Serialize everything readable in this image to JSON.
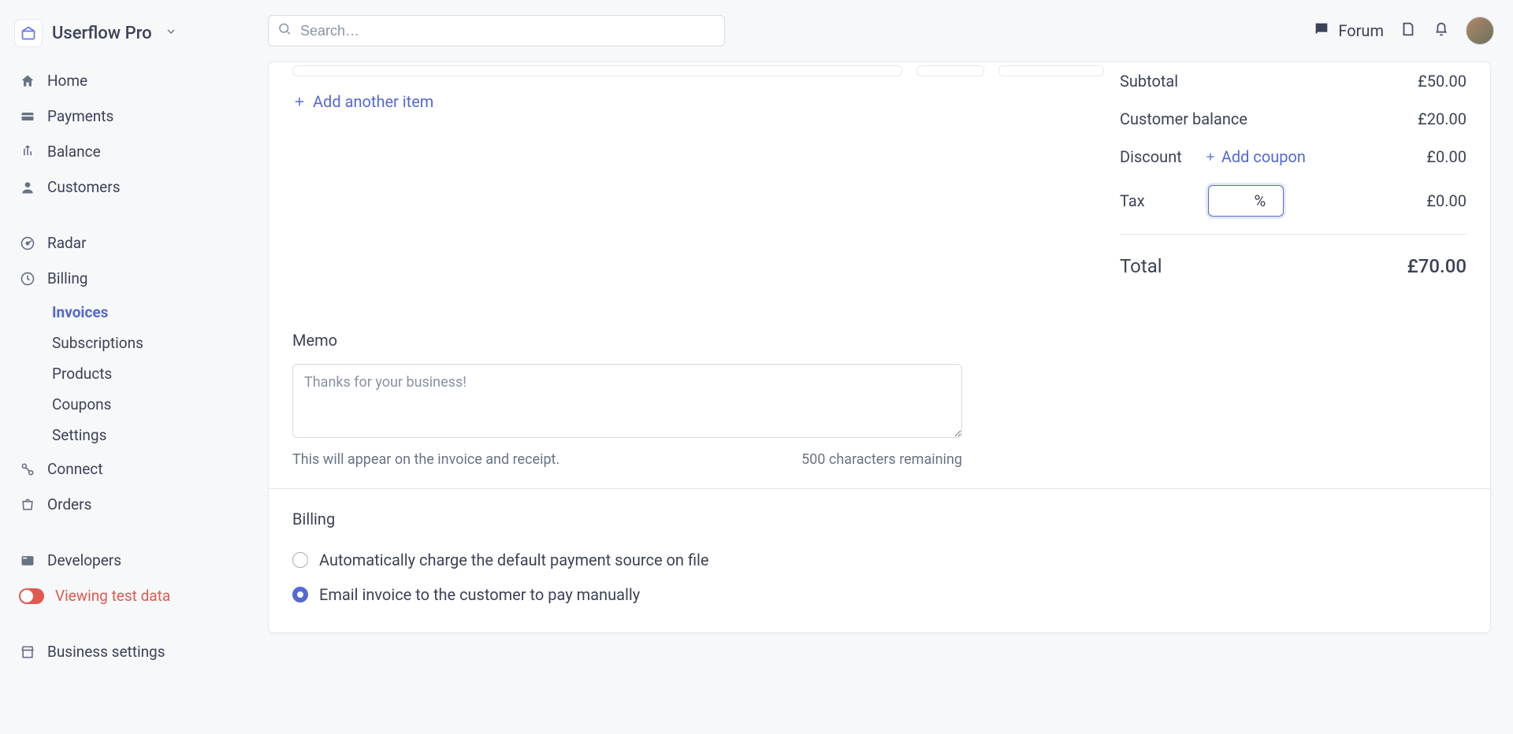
{
  "workspace": {
    "name": "Userflow Pro"
  },
  "search": {
    "placeholder": "Search…"
  },
  "topbar": {
    "forum": "Forum"
  },
  "sidebar": {
    "home": "Home",
    "payments": "Payments",
    "balance": "Balance",
    "customers": "Customers",
    "radar": "Radar",
    "billing": "Billing",
    "billing_sub": {
      "invoices": "Invoices",
      "subscriptions": "Subscriptions",
      "products": "Products",
      "coupons": "Coupons",
      "settings": "Settings"
    },
    "connect": "Connect",
    "orders": "Orders",
    "developers": "Developers",
    "test_data": "Viewing test data",
    "business_settings": "Business settings"
  },
  "items": {
    "add_another": "Add another item"
  },
  "totals": {
    "subtotal_label": "Subtotal",
    "subtotal_value": "£50.00",
    "customer_balance_label": "Customer balance",
    "customer_balance_value": "£20.00",
    "discount_label": "Discount",
    "add_coupon": "Add coupon",
    "discount_value": "£0.00",
    "tax_label": "Tax",
    "tax_unit": "%",
    "tax_value": "£0.00",
    "total_label": "Total",
    "total_value": "£70.00"
  },
  "memo": {
    "title": "Memo",
    "placeholder": "Thanks for your business!",
    "hint": "This will appear on the invoice and receipt.",
    "remaining": "500 characters remaining"
  },
  "billing": {
    "title": "Billing",
    "option_auto": "Automatically charge the default payment source on file",
    "option_email": "Email invoice to the customer to pay manually"
  }
}
